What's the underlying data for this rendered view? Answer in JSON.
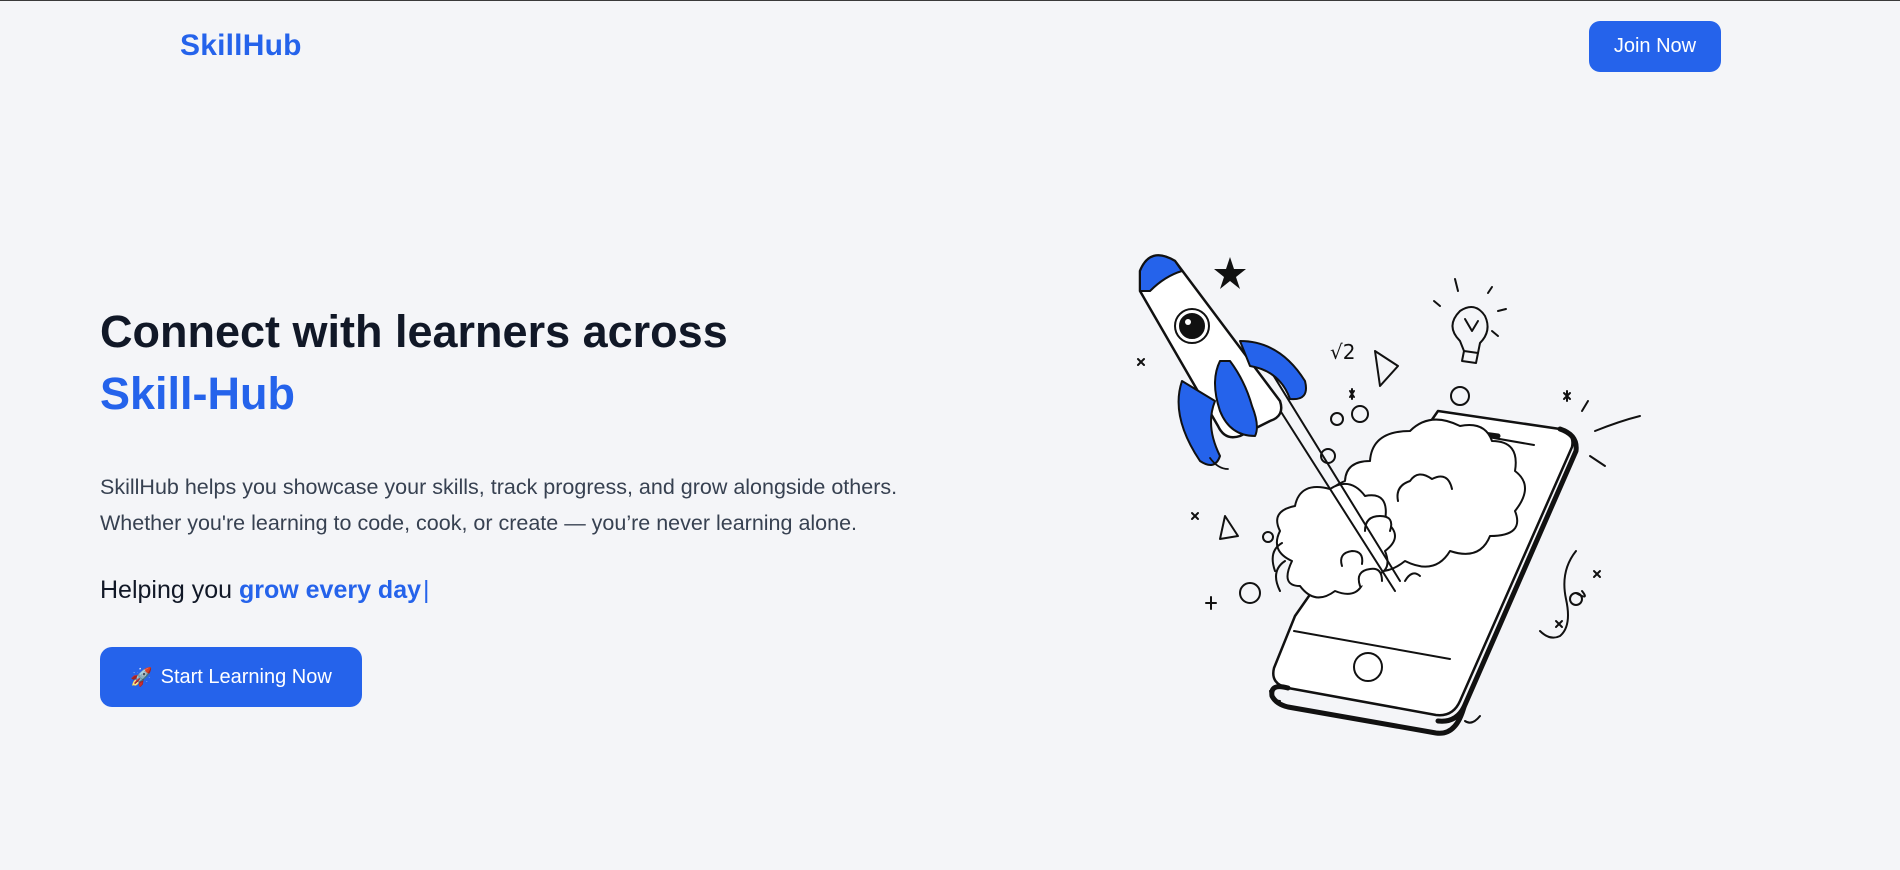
{
  "nav": {
    "logo": "SkillHub",
    "join_label": "Join Now"
  },
  "hero": {
    "headline_line1": "Connect with learners across",
    "headline_accent": "Skill-Hub",
    "description_line1": "SkillHub helps you showcase your skills, track progress, and grow alongside others.",
    "description_line2": "Whether you're learning to code, cook, or create — you’re never learning alone.",
    "tagline_prefix": "Helping you ",
    "tagline_typed": "grow every day",
    "tagline_cursor": "|",
    "cta_icon": "🚀",
    "cta_label": "Start Learning Now"
  },
  "illustration": {
    "name": "rocket-launching-from-phone-illustration",
    "math_symbol": "√2"
  },
  "colors": {
    "accent": "#2563eb",
    "background": "#f4f5f8",
    "text_dark": "#111827",
    "text_muted": "#374151"
  }
}
